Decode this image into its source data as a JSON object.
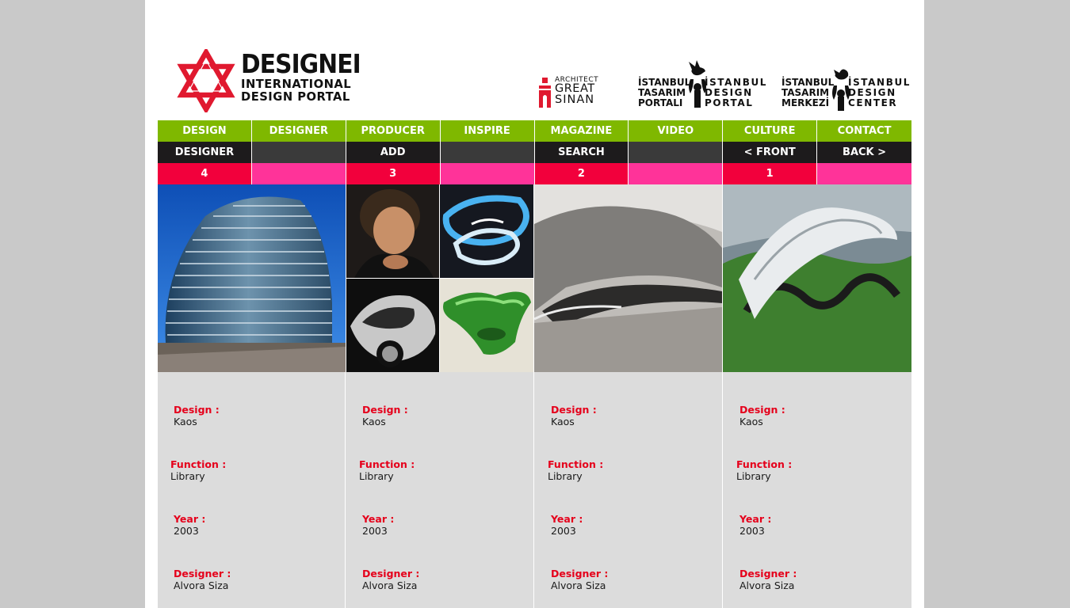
{
  "logo": {
    "title": "DESIGNEI",
    "line1": "INTERNATIONAL",
    "line2": "DESIGN PORTAL"
  },
  "partners": {
    "sinan": {
      "architect": "ARCHITECT",
      "great": "GREAT",
      "sinan": "SINAN"
    },
    "portal": {
      "left": [
        "İSTANBUL",
        "TASARIM",
        "PORTALI"
      ],
      "right": [
        "İSTANBUL",
        "DESIGN",
        "PORTAL"
      ]
    },
    "center": {
      "left": [
        "İSTANBUL",
        "TASARIM",
        "MERKEZİ"
      ],
      "right": [
        "İSTANBUL",
        "DESIGN",
        "CENTER"
      ]
    }
  },
  "nav": {
    "main": [
      "DESIGN",
      "DESIGNER",
      "PRODUCER",
      "INSPIRE",
      "MAGAZINE",
      "VIDEO",
      "CULTURE",
      "CONTACT"
    ],
    "sub": [
      "DESIGNER",
      "",
      "ADD",
      "",
      "SEARCH",
      "",
      "< FRONT",
      "BACK >"
    ],
    "pages": [
      "4",
      "",
      "3",
      "",
      "2",
      "",
      "1",
      ""
    ]
  },
  "items": [
    {
      "design_label": "Design :",
      "design": "Kaos",
      "function_label": "Function :",
      "function": "Library",
      "year_label": "Year :",
      "year": "2003",
      "designer_label": "Designer :",
      "designer": "Alvora Siza"
    },
    {
      "design_label": "Design :",
      "design": "Kaos",
      "function_label": "Function :",
      "function": "Library",
      "year_label": "Year :",
      "year": "2003",
      "designer_label": "Designer :",
      "designer": "Alvora Siza"
    },
    {
      "design_label": "Design :",
      "design": "Kaos",
      "function_label": "Function :",
      "function": "Library",
      "year_label": "Year :",
      "year": "2003",
      "designer_label": "Designer :",
      "designer": "Alvora Siza"
    },
    {
      "design_label": "Design :",
      "design": "Kaos",
      "function_label": "Function :",
      "function": "Library",
      "year_label": "Year :",
      "year": "2003",
      "designer_label": "Designer :",
      "designer": "Alvora Siza"
    }
  ],
  "colors": {
    "menu_green": "#7fb800",
    "menu_black": "#1d1b1c",
    "page_red": "#f2003c",
    "page_pink": "#ff3399",
    "label_red": "#e5001b",
    "info_bg": "#dcdcdc"
  }
}
